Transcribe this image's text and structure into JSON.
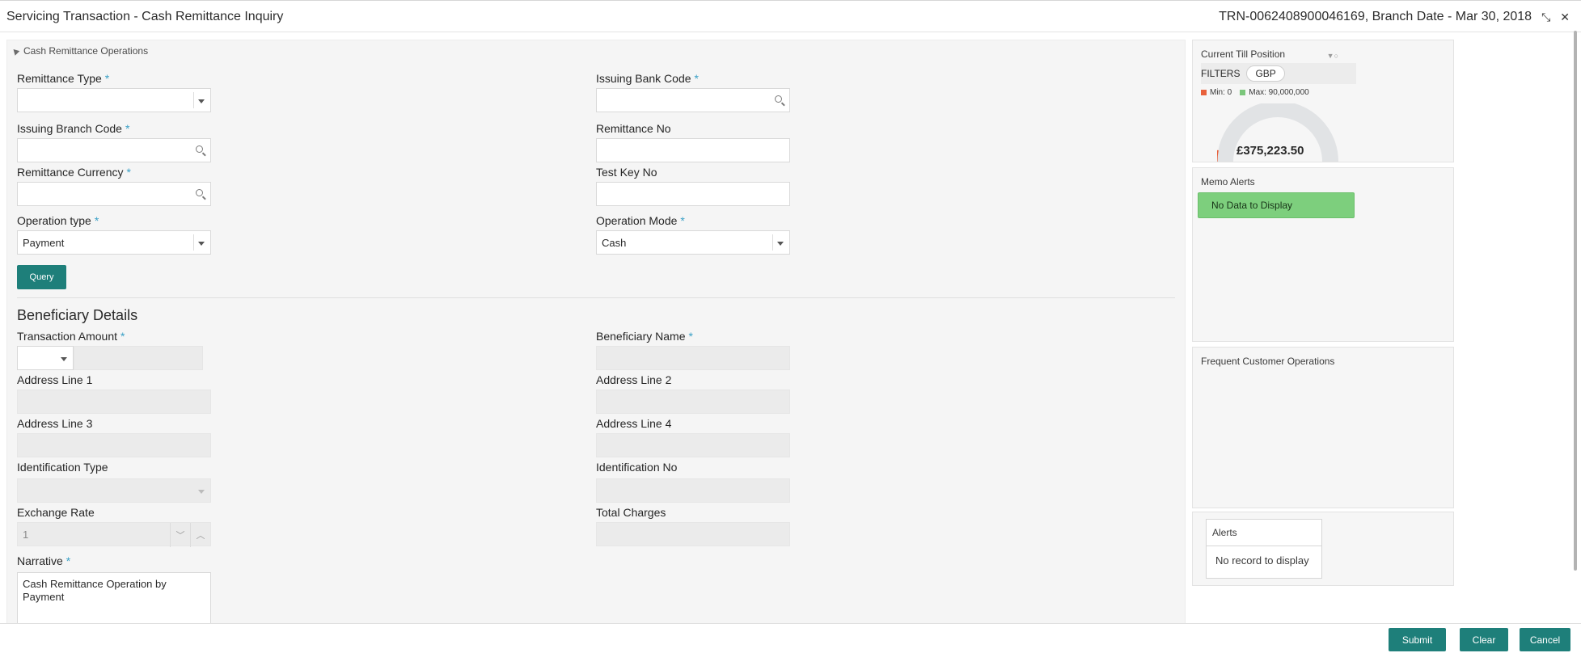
{
  "header": {
    "title": "Servicing Transaction - Cash Remittance Inquiry",
    "reference": "TRN-0062408900046169, Branch Date - Mar 30, 2018",
    "collapse_icon": "collapse-arrows-icon",
    "close_icon": "close-icon"
  },
  "section": {
    "title": "Cash Remittance Operations",
    "fields": {
      "remittance_type": {
        "label": "Remittance Type",
        "value": ""
      },
      "issuing_bank_code": {
        "label": "Issuing Bank Code",
        "value": ""
      },
      "issuing_branch_code": {
        "label": "Issuing Branch Code",
        "value": ""
      },
      "remittance_no": {
        "label": "Remittance No",
        "value": ""
      },
      "remittance_currency": {
        "label": "Remittance Currency",
        "value": ""
      },
      "test_key_no": {
        "label": "Test Key No",
        "value": ""
      },
      "operation_type": {
        "label": "Operation type",
        "value": "Payment"
      },
      "operation_mode": {
        "label": "Operation Mode",
        "value": "Cash"
      }
    },
    "query_button": "Query",
    "required_mark": "*"
  },
  "beneficiary": {
    "title": "Beneficiary Details",
    "fields": {
      "transaction_amount": {
        "label": "Transaction Amount",
        "currency": "",
        "value": ""
      },
      "beneficiary_name": {
        "label": "Beneficiary Name",
        "value": ""
      },
      "address_line_1": {
        "label": "Address Line 1",
        "value": ""
      },
      "address_line_2": {
        "label": "Address Line 2",
        "value": ""
      },
      "address_line_3": {
        "label": "Address Line 3",
        "value": ""
      },
      "address_line_4": {
        "label": "Address Line 4",
        "value": ""
      },
      "identification_type": {
        "label": "Identification Type",
        "value": ""
      },
      "identification_no": {
        "label": "Identification No",
        "value": ""
      },
      "exchange_rate": {
        "label": "Exchange Rate",
        "value": "1"
      },
      "total_charges": {
        "label": "Total Charges",
        "value": ""
      },
      "narrative": {
        "label": "Narrative",
        "value": "Cash Remittance Operation by Payment"
      }
    }
  },
  "till": {
    "title": "Current Till Position",
    "filters_label": "FILTERS",
    "currency_chip": "GBP",
    "min_label": "Min: 0",
    "max_label": "Max: 90,000,000",
    "value_label": "£375,223.50",
    "min": 0,
    "max": 90000000,
    "value": 375223.5,
    "min_color": "#e8613c",
    "max_color": "#7bc67b"
  },
  "memo": {
    "title": "Memo Alerts",
    "empty": "No Data to Display"
  },
  "frequent": {
    "title": "Frequent Customer Operations"
  },
  "alerts": {
    "title": "Alerts",
    "empty": "No record to display"
  },
  "footer": {
    "submit": "Submit",
    "clear": "Clear",
    "cancel": "Cancel"
  },
  "colors": {
    "primary_button": "#1e7f7a",
    "required_asterisk": "#3aa0c6"
  }
}
